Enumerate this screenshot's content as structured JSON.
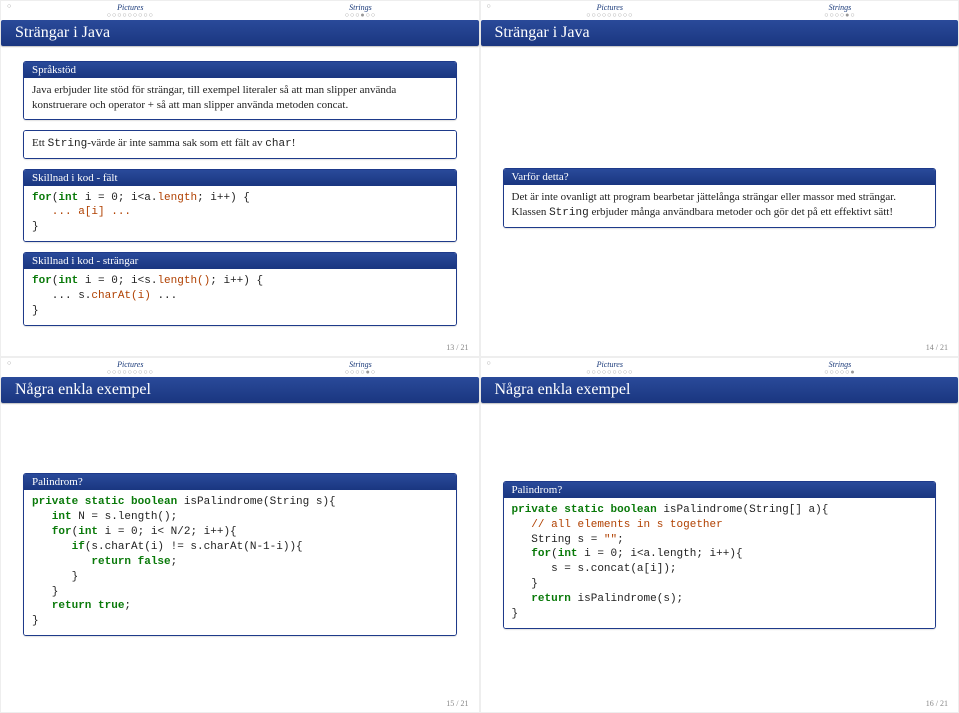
{
  "nav": {
    "sec1": "Pictures",
    "sec2": "Strings",
    "dots1": "○○○○○○○○○",
    "dots2_s13": "○○○●○○",
    "dots2_s14": "○○○○●○",
    "dots2_s15": "○○○○●○",
    "dots2_s16": "○○○○○●",
    "blank": "○"
  },
  "s13": {
    "title": "Strängar i Java",
    "b1_title": "Språkstöd",
    "b1_body": "Java erbjuder lite stöd för strängar, till exempel literaler så att man slipper använda konstruerare och operator + så att man slipper använda metoden concat.",
    "b2_body_pre": "Ett ",
    "b2_body_code": "String",
    "b2_body_post": "-värde är inte samma sak som ett fält av ",
    "b2_body_code2": "char",
    "b2_body_end": "!",
    "b3_title": "Skillnad i kod - fält",
    "b3_l1a": "for",
    "b3_l1b": "(",
    "b3_l1c": "int",
    "b3_l1d": " i = 0; i<a.",
    "b3_l1e": "length",
    "b3_l1f": "; i++) {",
    "b3_l2": "   ... a[i] ...",
    "b3_l3": "}",
    "b4_title": "Skillnad i kod - strängar",
    "b4_l1a": "for",
    "b4_l1b": "(",
    "b4_l1c": "int",
    "b4_l1d": " i = 0; i<s.",
    "b4_l1e": "length()",
    "b4_l1f": "; i++) {",
    "b4_l2a": "   ... s.",
    "b4_l2b": "charAt(i)",
    "b4_l2c": " ...",
    "b4_l3": "}",
    "foot": "13 / 21"
  },
  "s14": {
    "title": "Strängar i Java",
    "b1_title": "Varför detta?",
    "b1_body_a": "Det är inte ovanligt att program bearbetar jättelånga strängar eller massor med strängar. Klassen ",
    "b1_body_b": "String",
    "b1_body_c": " erbjuder många användbara metoder och gör det på ett effektivt sätt!",
    "foot": "14 / 21"
  },
  "s15": {
    "title": "Några enkla exempel",
    "b1_title": "Palindrom?",
    "l1a": "private static boolean",
    "l1b": " isPalindrome(String s){",
    "l2a": "   int",
    "l2b": " N = s.length();",
    "l3a": "   for",
    "l3b": "(",
    "l3c": "int",
    "l3d": " i = 0; i< N/2; i++){",
    "l4a": "      if",
    "l4b": "(s.charAt(i) != s.charAt(N-1-i)){",
    "l5a": "         return false",
    "l5b": ";",
    "l6": "      }",
    "l7": "   }",
    "l8a": "   return true",
    "l8b": ";",
    "l9": "}",
    "foot": "15 / 21"
  },
  "s16": {
    "title": "Några enkla exempel",
    "b1_title": "Palindrom?",
    "l1a": "private static boolean",
    "l1b": " isPalindrome(String[] a){",
    "l2": "   // all elements in s together",
    "l3a": "   String s = ",
    "l3b": "\"\"",
    "l3c": ";",
    "l4a": "   for",
    "l4b": "(",
    "l4c": "int",
    "l4d": " i = 0; i<a.length; i++){",
    "l5": "      s = s.concat(a[i]);",
    "l6": "   }",
    "l7a": "   return",
    "l7b": " isPalindrome(s);",
    "l8": "}",
    "foot": "16 / 21"
  }
}
